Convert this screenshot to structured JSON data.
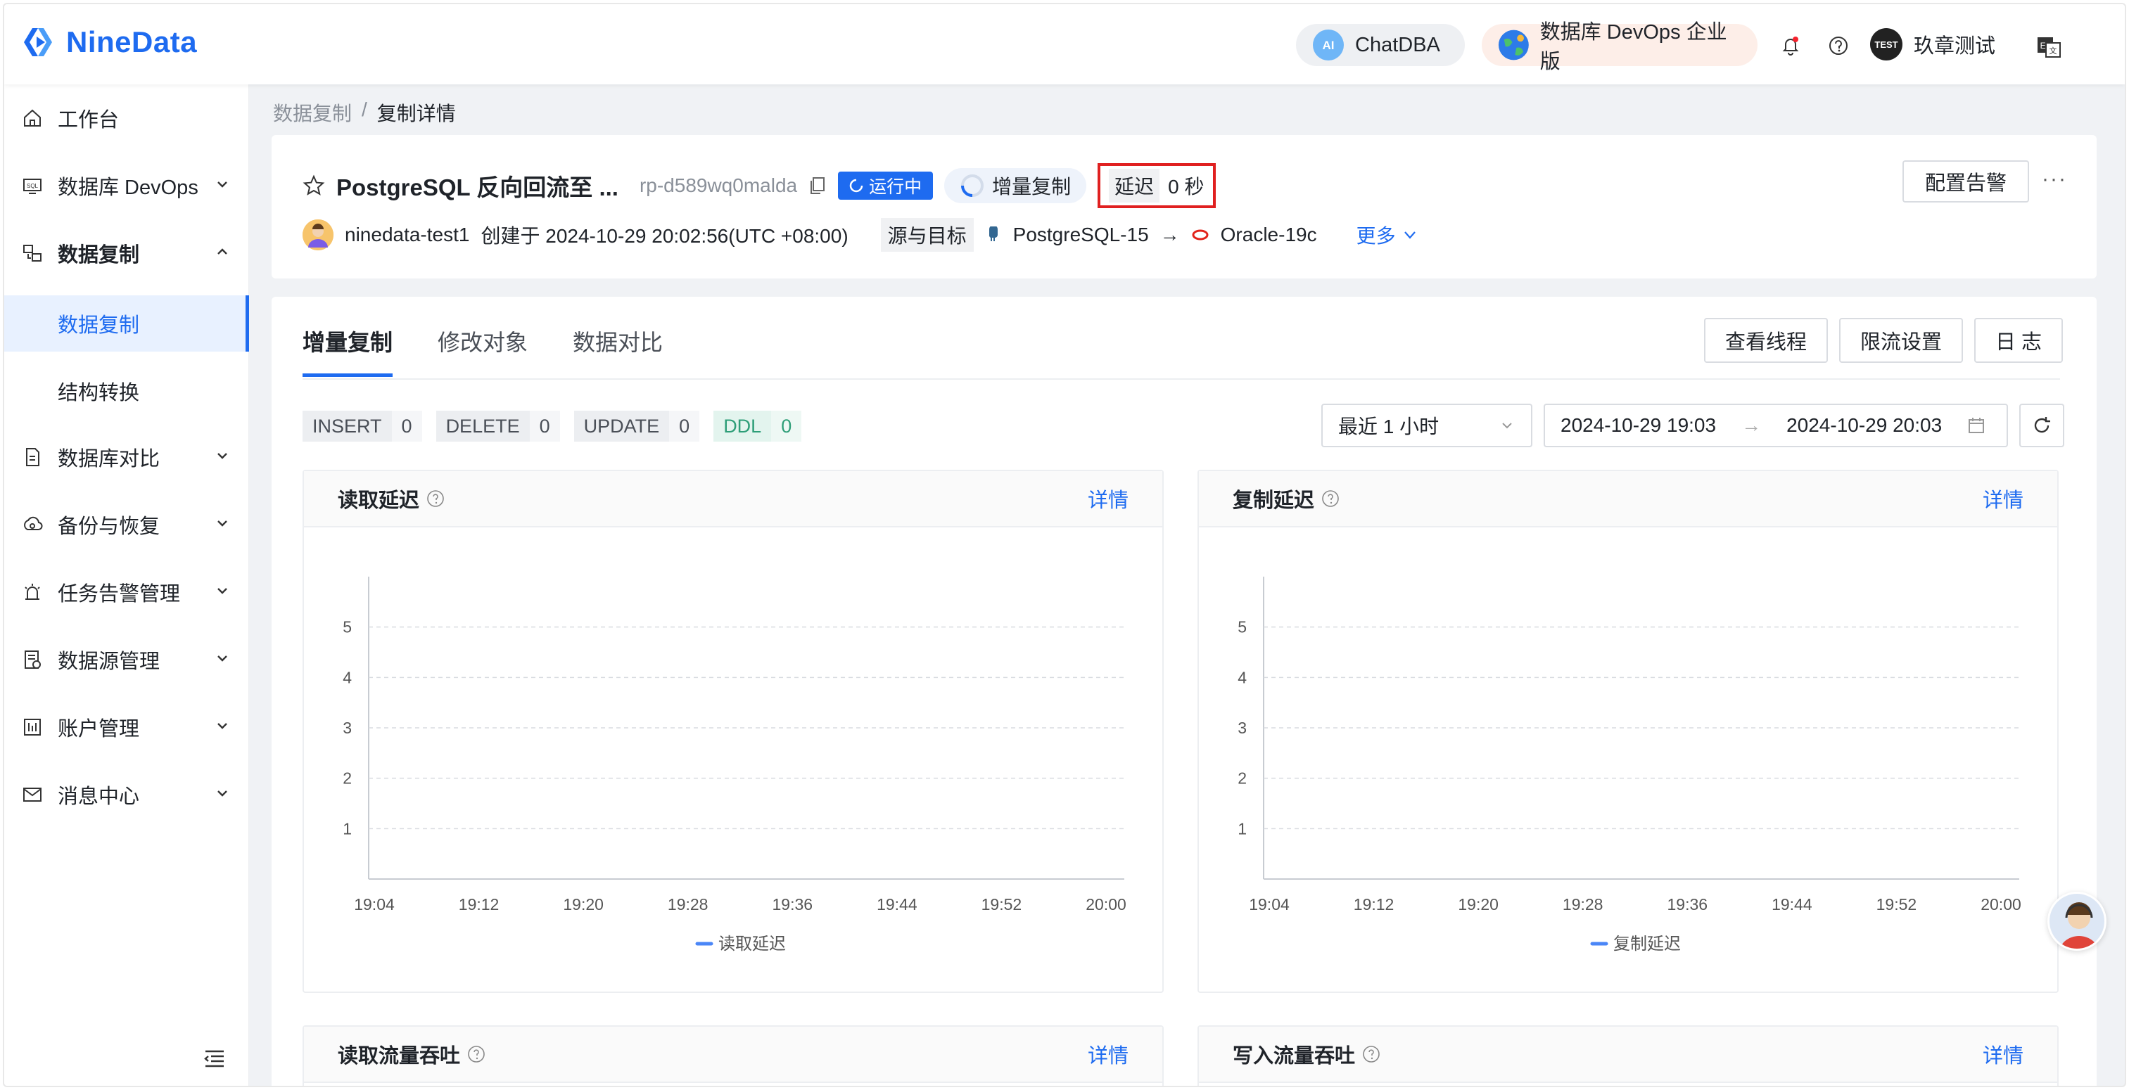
{
  "app": {
    "logo_text": "NineData",
    "brand_color": "#1e6bf0"
  },
  "topbar": {
    "chatdba_label": "ChatDBA",
    "devops_label": "数据库 DevOps 企业版",
    "user_name": "玖章测试",
    "user_avatar_text": "TEST"
  },
  "sidebar": {
    "items": [
      {
        "label": "工作台",
        "icon": "home-icon"
      },
      {
        "label": "数据库 DevOps",
        "icon": "devops-icon"
      },
      {
        "label": "数据复制",
        "icon": "replication-icon"
      },
      {
        "label": "数据库对比",
        "icon": "compare-icon"
      },
      {
        "label": "备份与恢复",
        "icon": "backup-icon"
      },
      {
        "label": "任务告警管理",
        "icon": "alarm-icon"
      },
      {
        "label": "数据源管理",
        "icon": "datasource-icon"
      },
      {
        "label": "账户管理",
        "icon": "account-icon"
      },
      {
        "label": "消息中心",
        "icon": "mail-icon"
      }
    ],
    "subitems": [
      {
        "label": "数据复制"
      },
      {
        "label": "结构转换"
      }
    ]
  },
  "breadcrumb": {
    "parent": "数据复制",
    "separator": "/",
    "current": "复制详情"
  },
  "task": {
    "title": "PostgreSQL 反向回流至 ...",
    "id": "rp-d589wq0malda",
    "status": "运行中",
    "mode": "增量复制",
    "delay_label": "延迟",
    "delay_value": "0 秒",
    "alert_button": "配置告警",
    "more_dots": "···",
    "creator": "ninedata-test1",
    "created_text": "创建于 2024-10-29 20:02:56(UTC +08:00)",
    "src_target_label": "源与目标",
    "source": "PostgreSQL-15",
    "arrow": "→",
    "target": "Oracle-19c",
    "more_link": "更多"
  },
  "tabs": [
    {
      "label": "增量复制",
      "active": true
    },
    {
      "label": "修改对象",
      "active": false
    },
    {
      "label": "数据对比",
      "active": false
    }
  ],
  "actions": {
    "threads": "查看线程",
    "throttle": "限流设置",
    "log": "日 志"
  },
  "stats": [
    {
      "key": "INSERT",
      "value": "0"
    },
    {
      "key": "DELETE",
      "value": "0"
    },
    {
      "key": "UPDATE",
      "value": "0"
    },
    {
      "key": "DDL",
      "value": "0"
    }
  ],
  "filters": {
    "range": "最近 1 小时",
    "start": "2024-10-29 19:03",
    "end": "2024-10-29 20:03",
    "range_arrow": "→"
  },
  "panels": [
    {
      "title": "读取延迟",
      "link": "详情"
    },
    {
      "title": "复制延迟",
      "link": "详情"
    },
    {
      "title": "读取流量吞吐",
      "link": "详情"
    },
    {
      "title": "写入流量吞吐",
      "link": "详情"
    }
  ],
  "chart_data": [
    {
      "type": "line",
      "title": "",
      "x": [
        "19:04",
        "19:12",
        "19:20",
        "19:28",
        "19:36",
        "19:44",
        "19:52",
        "20:00"
      ],
      "y_ticks": [
        1,
        2,
        3,
        4,
        5
      ],
      "ylim": [
        0,
        6
      ],
      "series": [
        {
          "name": "读取延迟",
          "values": []
        }
      ],
      "legend": "bottom",
      "grid": true,
      "color": "#4a86f7"
    },
    {
      "type": "line",
      "title": "",
      "x": [
        "19:04",
        "19:12",
        "19:20",
        "19:28",
        "19:36",
        "19:44",
        "19:52",
        "20:00"
      ],
      "y_ticks": [
        1,
        2,
        3,
        4,
        5
      ],
      "ylim": [
        0,
        6
      ],
      "series": [
        {
          "name": "复制延迟",
          "values": []
        }
      ],
      "legend": "bottom",
      "grid": true,
      "color": "#4a86f7"
    }
  ]
}
